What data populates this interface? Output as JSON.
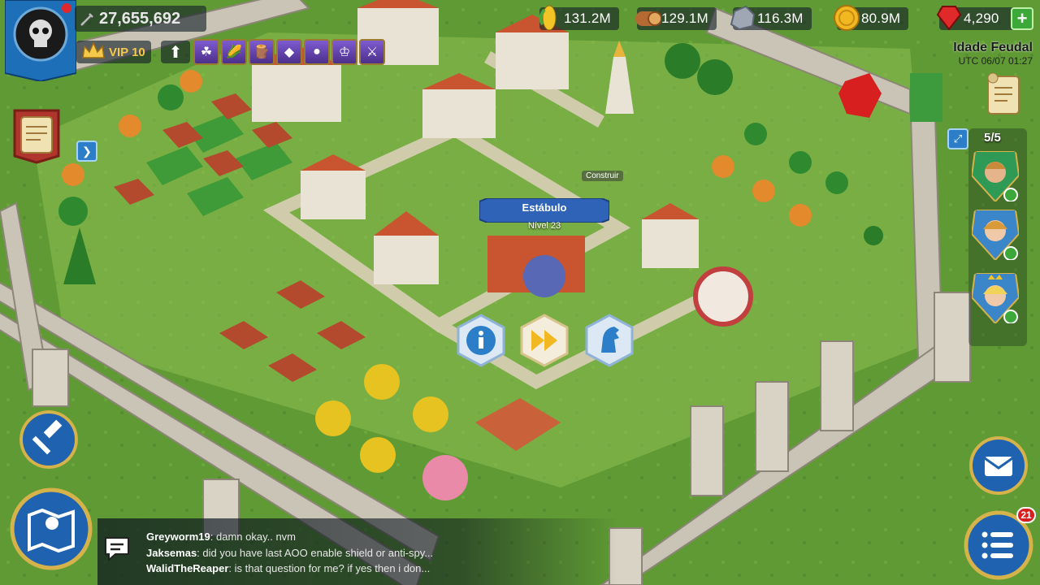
{
  "player": {
    "power": "27,655,692",
    "vip": "VIP 10"
  },
  "resources": {
    "food": "131.2M",
    "wood": "129.1M",
    "stone": "116.3M",
    "gold": "80.9M",
    "gems": "4,290"
  },
  "era": {
    "name": "Idade Feudal",
    "time": "UTC 06/07 01:27"
  },
  "commanders": {
    "count": "5/5"
  },
  "selected_building": {
    "name": "Estábulo",
    "level": "Nível 23",
    "tooltip": "Construir"
  },
  "menu": {
    "badge": "21"
  },
  "chat": [
    {
      "name": "Greyworm19",
      "text": ": damn okay.. nvm"
    },
    {
      "name": "Jaksemas",
      "text": ": did you have last AOO enable shield or  anti-spy..."
    },
    {
      "name": "WalidTheReaper",
      "text": ": is that question for me? if yes then i don..."
    }
  ],
  "colors": {
    "grass": "#5f9a34",
    "wall": "#c9c4b6",
    "button_blue": "#2c7ec9",
    "gem_red": "#d71f1f",
    "gold_text": "#f3c84b"
  }
}
